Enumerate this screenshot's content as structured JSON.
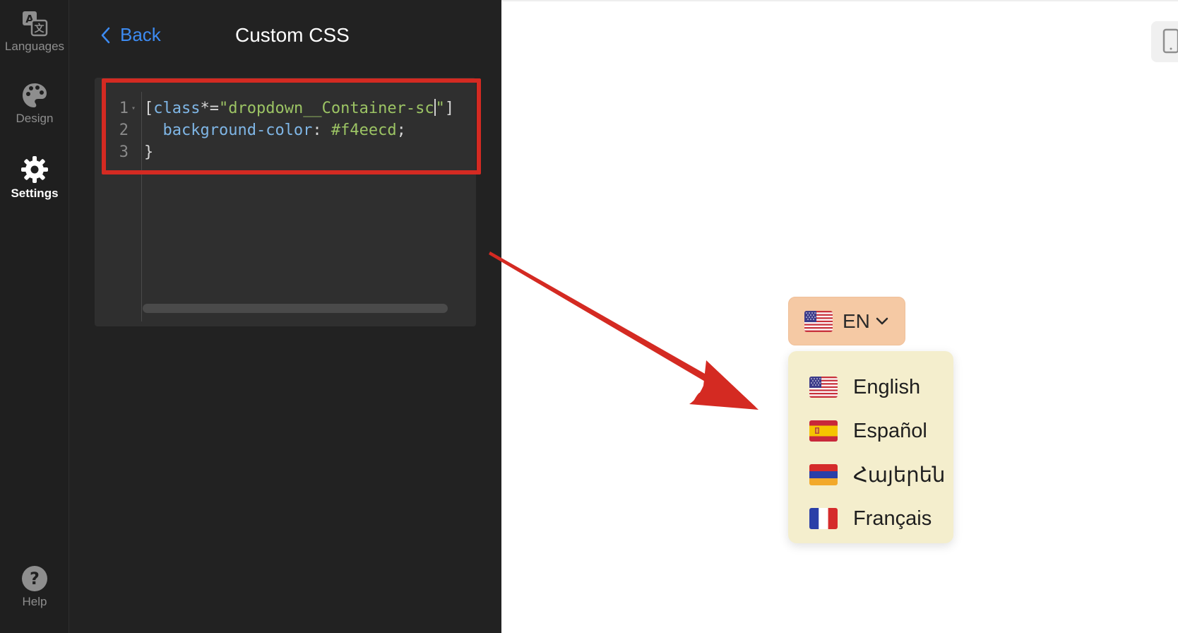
{
  "rail": {
    "items": [
      {
        "label": "Languages",
        "icon": "translate-icon"
      },
      {
        "label": "Design",
        "icon": "palette-icon"
      },
      {
        "label": "Settings",
        "icon": "gear-icon",
        "active": true
      },
      {
        "label": "Help",
        "icon": "help-icon"
      }
    ]
  },
  "panel": {
    "back_label": "Back",
    "title": "Custom CSS"
  },
  "editor": {
    "lines": [
      {
        "number": "1",
        "selector_open": "[",
        "attr": "class",
        "op": "*=",
        "string": "\"dropdown__Container-sc",
        "string_tail": "\"",
        "close": "]"
      },
      {
        "number": "2",
        "property": "background-color",
        "colon": ": ",
        "value": "#f4eecd",
        "semicolon": ";"
      },
      {
        "number": "3",
        "brace": "}"
      }
    ]
  },
  "preview": {
    "selected_language": {
      "code": "EN",
      "flag": "us-flag"
    },
    "dropdown_background": "#f4eecd",
    "button_background": "#f5c9a4",
    "languages": [
      {
        "name": "English",
        "flag": "us-flag"
      },
      {
        "name": "Español",
        "flag": "spain-flag"
      },
      {
        "name": "Հայերեն",
        "flag": "armenia-flag"
      },
      {
        "name": "Français",
        "flag": "france-flag"
      }
    ]
  },
  "colors": {
    "accent": "#3d8bf2",
    "highlight_border": "#d42a22",
    "arrow": "#d42a22"
  }
}
